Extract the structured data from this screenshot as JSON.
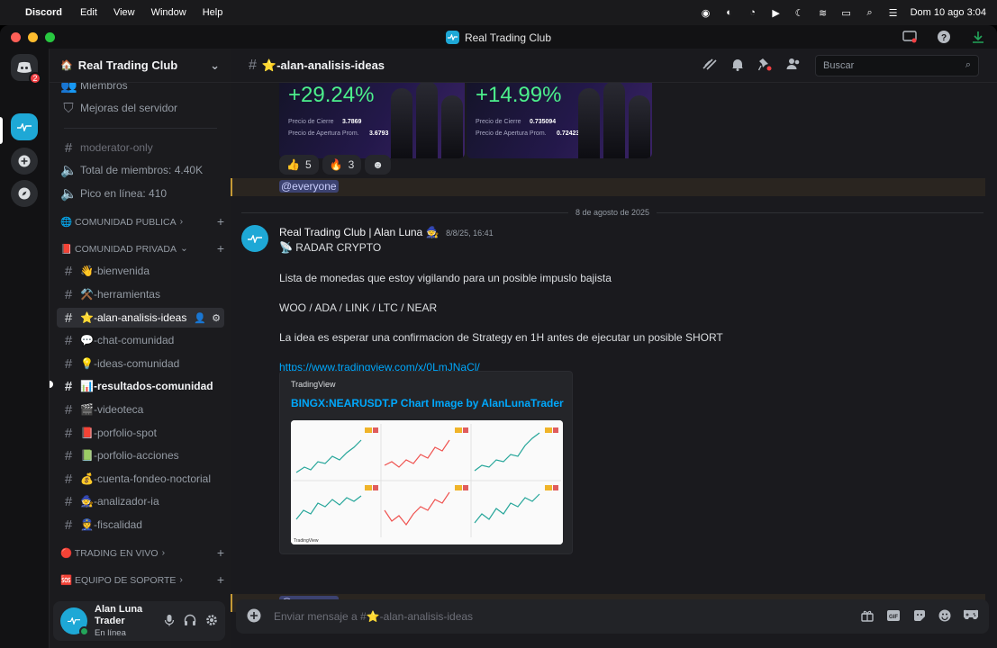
{
  "menubar": {
    "app": "Discord",
    "menus": [
      "Edit",
      "View",
      "Window",
      "Help"
    ],
    "clock": "Dom 10 ago 3:04"
  },
  "window": {
    "title": "Real Trading Club"
  },
  "servers": {
    "dm_badge": "2"
  },
  "server": {
    "name": "Real Trading Club",
    "top_items": [
      "Miembros",
      "Mejoras del servidor"
    ],
    "stat_items": [
      "moderator-only",
      "Total de miembros: 4.40K",
      "Pico en línea: 410"
    ],
    "categories": [
      {
        "label": "🌐 COMUNIDAD PUBLICA"
      },
      {
        "label": "📕 COMUNIDAD PRIVADA"
      },
      {
        "label": "🔴 TRADING EN VIVO"
      },
      {
        "label": "🆘 EQUIPO DE SOPORTE"
      }
    ],
    "channels": [
      {
        "label": "👋-bienvenida"
      },
      {
        "label": "⚒️-herramientas"
      },
      {
        "label": "⭐-alan-analisis-ideas"
      },
      {
        "label": "💬-chat-comunidad"
      },
      {
        "label": "💡-ideas-comunidad"
      },
      {
        "label": "📊-resultados-comunidad"
      },
      {
        "label": "🎬-videoteca"
      },
      {
        "label": "📕-porfolio-spot"
      },
      {
        "label": "📗-porfolio-acciones"
      },
      {
        "label": "💰-cuenta-fondeo-noctorial"
      },
      {
        "label": "🧙-analizador-ia"
      },
      {
        "label": "👮-fiscalidad"
      }
    ]
  },
  "user": {
    "name": "Alan Luna Trader",
    "status": "En línea"
  },
  "channel": {
    "title": "⭐-alan-analisis-ideas",
    "search_placeholder": "Buscar"
  },
  "promos": [
    {
      "pct": "+29.24%",
      "close_label": "Precio de Cierre",
      "close_val": "3.7869",
      "open_label": "Precio de Apertura Prom.",
      "open_val": "3.6793"
    },
    {
      "pct": "+14.99%",
      "close_label": "Precio de Cierre",
      "close_val": "0.735094",
      "open_label": "Precio de Apertura Prom.",
      "open_val": "0.724235"
    }
  ],
  "reactions": [
    {
      "emoji": "👍",
      "count": "5"
    },
    {
      "emoji": "🔥",
      "count": "3"
    }
  ],
  "mention": "@everyone",
  "date_divider": "8 de agosto de 2025",
  "message": {
    "author": "Real Trading Club | Alan Luna 🧙",
    "timestamp": "8/8/25, 16:41",
    "lines": [
      "📡 RADAR CRYPTO",
      "Lista de monedas que estoy vigilando para un posible impuslo bajista",
      "WOO / ADA / LINK / LTC / NEAR",
      "La idea es esperar una confirmacion de Strategy en 1H antes de ejecutar un posible SHORT"
    ],
    "link": "https://www.tradingview.com/x/0LmJNaCl/",
    "embed": {
      "provider": "TradingView",
      "title": "BINGX:NEARUSDT.P Chart Image by AlanLunaTrader",
      "footer": "TradingView"
    }
  },
  "composer": {
    "placeholder": "Enviar mensaje a #⭐-alan-analisis-ideas"
  }
}
